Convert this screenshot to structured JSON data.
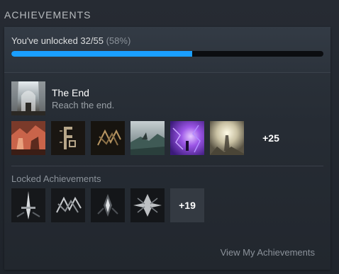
{
  "header": {
    "title": "ACHIEVEMENTS"
  },
  "progress": {
    "prefix": "You've unlocked ",
    "unlocked": "32/55",
    "percent_text": "(58%)",
    "fraction": 0.58,
    "bar_color": "#1a9fff"
  },
  "latest": {
    "name": "The End",
    "description": "Reach the end.",
    "icon": "cathedral-icon"
  },
  "unlocked_icons": [
    {
      "icon": "ruins-red-icon"
    },
    {
      "icon": "gold-glyph-icon"
    },
    {
      "icon": "gold-rune-icon"
    },
    {
      "icon": "ship-landscape-icon"
    },
    {
      "icon": "purple-portal-icon"
    },
    {
      "icon": "light-figure-icon"
    }
  ],
  "unlocked_more": "+25",
  "locked": {
    "title": "Locked Achievements",
    "icons": [
      {
        "icon": "locked-sword-icon"
      },
      {
        "icon": "locked-rune-icon"
      },
      {
        "icon": "locked-spirit-icon"
      },
      {
        "icon": "locked-burst-icon"
      }
    ],
    "more": "+19"
  },
  "footer": {
    "link": "View My Achievements"
  }
}
